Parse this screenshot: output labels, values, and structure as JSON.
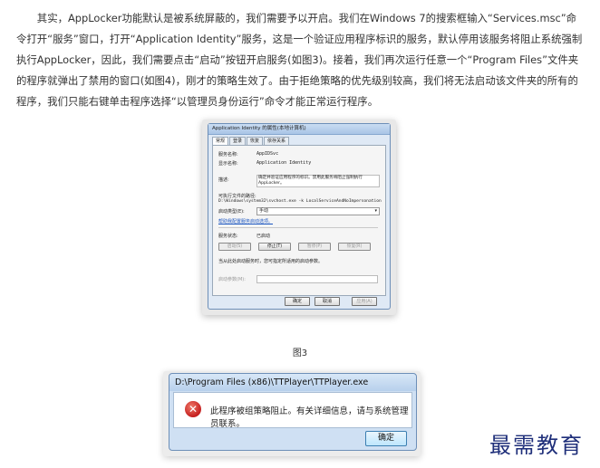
{
  "article": {
    "paragraph": "其实，AppLocker功能默认是被系统屏蔽的，我们需要予以开启。我们在Windows 7的搜索框输入“Services.msc”命令打开“服务”窗口，打开“Application Identity”服务，这是一个验证应用程序标识的服务，默认停用该服务将阻止系统强制执行AppLocker，因此，我们需要点击“启动”按钮开启服务(如图3)。接着，我们再次运行任意一个“Program Files”文件夹的程序就弹出了禁用的窗口(如图4)，刚才的策略生效了。由于拒绝策略的优先级别较高，我们将无法启动该文件夹的所有的程序，我们只能右键单击程序选择“以管理员身份运行”命令才能正常运行程序。",
    "figure3_caption": "图3"
  },
  "dialog": {
    "title": "Application Identity 的属性(本地计算机)",
    "tabs": [
      "常规",
      "登录",
      "恢复",
      "依存关系"
    ],
    "service_name_label": "服务名称:",
    "service_name": "AppIDSvc",
    "display_name_label": "显示名称:",
    "display_name": "Application Identity",
    "description_label": "描述:",
    "description": "确定并验证应用程序的标识。禁用此服务将阻止强制执行 AppLocker。",
    "exe_path_label": "可执行文件的路径:",
    "exe_path": "D:\\Windows\\system32\\svchost.exe -k LocalServiceAndNoImpersonation",
    "startup_type_label": "启动类型(E):",
    "startup_type": "手动",
    "help_link": "帮助我配置服务启动选项。",
    "status_label": "服务状态:",
    "status": "已启动",
    "buttons": {
      "start": "启动(S)",
      "stop": "停止(T)",
      "pause": "暂停(P)",
      "resume": "恢复(R)"
    },
    "hint": "当从此处启动服务时，您可指定所适用的启动参数。",
    "params_label": "启动参数(M):",
    "ok": "确定",
    "cancel": "取消",
    "apply": "应用(A)"
  },
  "message_box": {
    "title": "D:\\Program Files (x86)\\TTPlayer\\TTPlayer.exe",
    "icon": "error-icon",
    "text": "此程序被组策略阻止。有关详细信息，请与系统管理员联系。",
    "ok": "确定"
  },
  "watermark": "最需教育"
}
